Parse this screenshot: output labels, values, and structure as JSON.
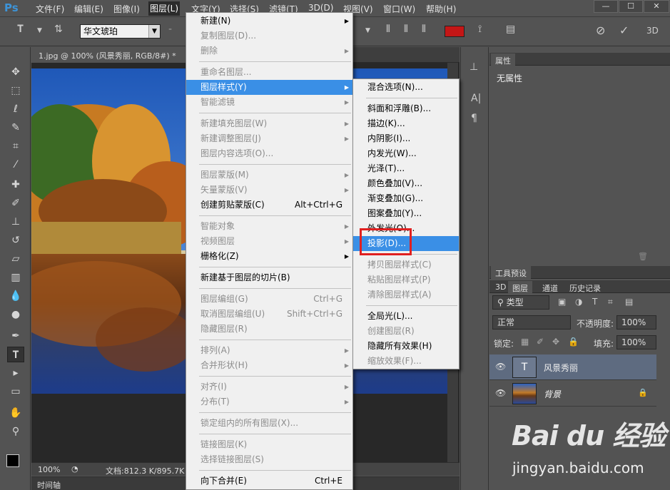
{
  "app": {
    "logo": "Ps"
  },
  "menubar": {
    "items": [
      "文件(F)",
      "编辑(E)",
      "图像(I)",
      "图层(L)",
      "文字(Y)",
      "选择(S)",
      "滤镜(T)",
      "3D(D)",
      "视图(V)",
      "窗口(W)",
      "帮助(H)"
    ],
    "active": "图层(L)"
  },
  "options": {
    "font_family": "华文琥珀",
    "color_swatch": "#c41616"
  },
  "document": {
    "tab_title": "1.jpg @ 100% (风景秀丽, RGB/8#) *",
    "zoom": "100%",
    "doc_info": "文档:812.3 K/895.7K"
  },
  "timeline": {
    "label": "时间轴"
  },
  "properties": {
    "tab": "属性",
    "empty_text": "无属性"
  },
  "tool_presets": {
    "tab": "工具预设"
  },
  "layers_panel": {
    "tabs": [
      "3D",
      "图层",
      "通道",
      "历史记录"
    ],
    "filter_kind": "类型",
    "blend_mode": "正常",
    "opacity_label": "不透明度:",
    "opacity_value": "100%",
    "lock_label": "锁定:",
    "fill_label": "填充:",
    "fill_value": "100%",
    "layers": [
      {
        "name": "风景秀丽",
        "type": "text",
        "selected": true
      },
      {
        "name": "背景",
        "type": "image",
        "locked": true
      }
    ]
  },
  "layer_menu": {
    "items": [
      {
        "label": "新建(N)",
        "submenu": true,
        "disabled": false
      },
      {
        "label": "复制图层(D)...",
        "disabled": true
      },
      {
        "label": "删除",
        "submenu": true,
        "disabled": true
      },
      {
        "sep": true
      },
      {
        "label": "重命名图层...",
        "disabled": true
      },
      {
        "label": "图层样式(Y)",
        "submenu": true,
        "highlighted": true
      },
      {
        "label": "智能滤镜",
        "submenu": true,
        "disabled": true
      },
      {
        "sep": true
      },
      {
        "label": "新建填充图层(W)",
        "submenu": true,
        "disabled": true
      },
      {
        "label": "新建调整图层(J)",
        "submenu": true,
        "disabled": true
      },
      {
        "label": "图层内容选项(O)...",
        "disabled": true
      },
      {
        "sep": true
      },
      {
        "label": "图层蒙版(M)",
        "submenu": true,
        "disabled": true
      },
      {
        "label": "矢量蒙版(V)",
        "submenu": true,
        "disabled": true
      },
      {
        "label": "创建剪贴蒙版(C)",
        "shortcut": "Alt+Ctrl+G",
        "disabled": false
      },
      {
        "sep": true
      },
      {
        "label": "智能对象",
        "submenu": true,
        "disabled": true
      },
      {
        "label": "视频图层",
        "submenu": true,
        "disabled": true
      },
      {
        "label": "栅格化(Z)",
        "submenu": true,
        "disabled": false
      },
      {
        "sep": true
      },
      {
        "label": "新建基于图层的切片(B)",
        "disabled": false
      },
      {
        "sep": true
      },
      {
        "label": "图层编组(G)",
        "shortcut": "Ctrl+G",
        "disabled": true
      },
      {
        "label": "取消图层编组(U)",
        "shortcut": "Shift+Ctrl+G",
        "disabled": true
      },
      {
        "label": "隐藏图层(R)",
        "disabled": true
      },
      {
        "sep": true
      },
      {
        "label": "排列(A)",
        "submenu": true,
        "disabled": true
      },
      {
        "label": "合并形状(H)",
        "submenu": true,
        "disabled": true
      },
      {
        "sep": true
      },
      {
        "label": "对齐(I)",
        "submenu": true,
        "disabled": true
      },
      {
        "label": "分布(T)",
        "submenu": true,
        "disabled": true
      },
      {
        "sep": true
      },
      {
        "label": "锁定组内的所有图层(X)...",
        "disabled": true
      },
      {
        "sep": true
      },
      {
        "label": "链接图层(K)",
        "disabled": true
      },
      {
        "label": "选择链接图层(S)",
        "disabled": true
      },
      {
        "sep": true
      },
      {
        "label": "向下合并(E)",
        "shortcut": "Ctrl+E",
        "disabled": false
      }
    ]
  },
  "style_submenu": {
    "items": [
      {
        "label": "混合选项(N)...",
        "disabled": false
      },
      {
        "sep": true
      },
      {
        "label": "斜面和浮雕(B)...",
        "disabled": false
      },
      {
        "label": "描边(K)...",
        "disabled": false
      },
      {
        "label": "内阴影(I)...",
        "disabled": false
      },
      {
        "label": "内发光(W)...",
        "disabled": false
      },
      {
        "label": "光泽(T)...",
        "disabled": false
      },
      {
        "label": "颜色叠加(V)...",
        "disabled": false
      },
      {
        "label": "渐变叠加(G)...",
        "disabled": false
      },
      {
        "label": "图案叠加(Y)...",
        "disabled": false
      },
      {
        "label": "外发光(O)...",
        "disabled": false
      },
      {
        "label": "投影(D)...",
        "highlighted": true
      },
      {
        "sep": true
      },
      {
        "label": "拷贝图层样式(C)",
        "disabled": true
      },
      {
        "label": "粘贴图层样式(P)",
        "disabled": true
      },
      {
        "label": "清除图层样式(A)",
        "disabled": true
      },
      {
        "sep": true
      },
      {
        "label": "全局光(L)...",
        "disabled": false
      },
      {
        "label": "创建图层(R)",
        "disabled": true
      },
      {
        "label": "隐藏所有效果(H)",
        "disabled": false
      },
      {
        "label": "缩放效果(F)...",
        "disabled": true
      }
    ]
  },
  "watermark": {
    "logo": "Bai du 经验",
    "site": "jingyan.baidu.com"
  }
}
